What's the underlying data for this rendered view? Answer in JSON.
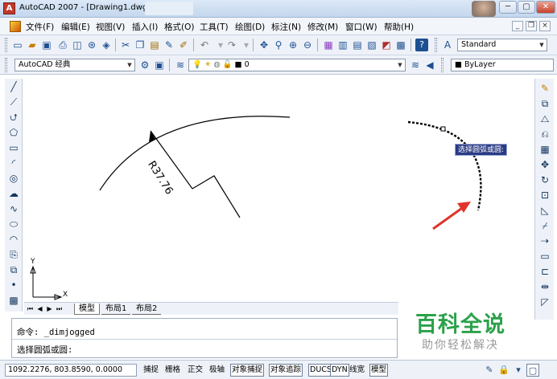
{
  "window": {
    "title": "AutoCAD 2007 - [Drawing1.dwg]",
    "min_label": "─",
    "max_label": "▢",
    "close_label": "✕"
  },
  "menu": {
    "items": [
      "文件(F)",
      "编辑(E)",
      "视图(V)",
      "插入(I)",
      "格式(O)",
      "工具(T)",
      "绘图(D)",
      "标注(N)",
      "修改(M)",
      "窗口(W)",
      "帮助(H)"
    ],
    "mdi_min": "_",
    "mdi_restore": "❐",
    "mdi_close": "×"
  },
  "toolbar1": {
    "text_style": "Standard"
  },
  "toolbar2": {
    "workspace": "AutoCAD 经典",
    "layer": "0",
    "color": "ByLayer"
  },
  "drawing": {
    "dimension_text": "R37.76",
    "tooltip": "选择圆弧或圆:",
    "ucs_x": "X",
    "ucs_y": "Y"
  },
  "tabs": {
    "items": [
      "模型",
      "布局1",
      "布局2"
    ],
    "active": "模型"
  },
  "command": {
    "line1": "命令: _dimjogged",
    "line2": "选择圆弧或圆:"
  },
  "watermark": {
    "title": "百科全说",
    "subtitle": "助你轻松解决"
  },
  "status": {
    "coordinates": "1092.2276, 803.8590, 0.0000",
    "buttons": [
      "捕捉",
      "栅格",
      "正交",
      "极轴",
      "对象捕捉",
      "对象追踪",
      "DUCS",
      "DYN",
      "线宽",
      "模型"
    ]
  },
  "colors": {
    "tooltip_bg": "#2a3a84",
    "arrow": "#e0352b",
    "watermark_green": "#2ba14a"
  }
}
